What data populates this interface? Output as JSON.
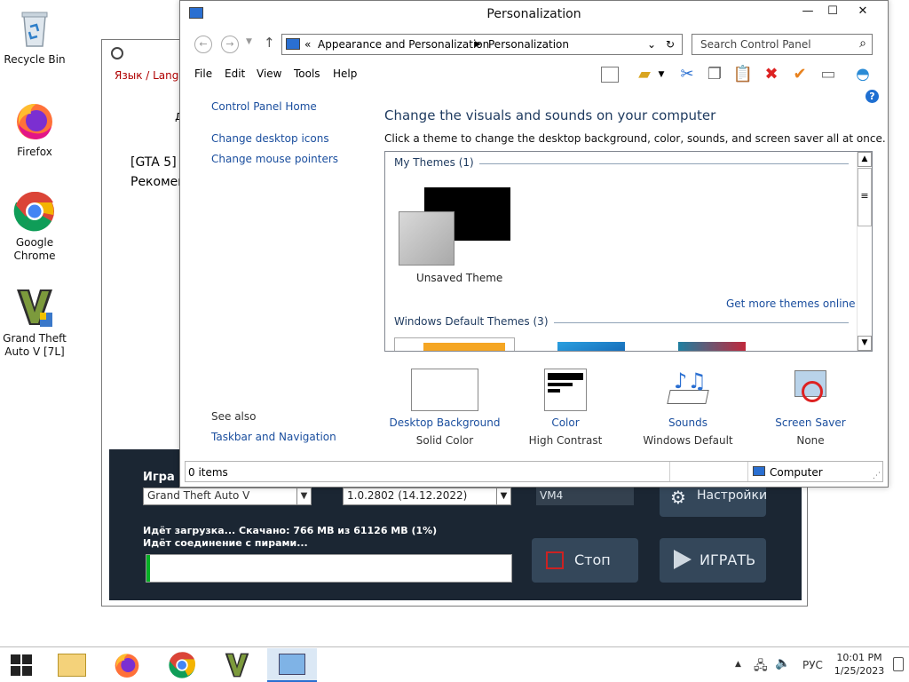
{
  "desktop": {
    "icons": [
      {
        "label": "Recycle Bin",
        "icon": "recycle-bin-icon"
      },
      {
        "label": "Firefox",
        "icon": "firefox-icon"
      },
      {
        "label": "Google Chrome",
        "icon": "chrome-icon"
      },
      {
        "label": "Grand Theft Auto V [7L]",
        "icon": "gta-v-icon"
      }
    ]
  },
  "launcher": {
    "lang_label": "Язык / Langu",
    "line1": "[GTA 5]",
    "line2": "Рекомен",
    "game_label": "Игра",
    "game_value": "Grand Theft Auto V",
    "version_value": "1.0.2802 (14.12.2022)",
    "vm_value": "VM4",
    "settings_label": "Настройки",
    "download_status": "Идёт загрузка... Скачано: 766 MB из 61126 MB (1%)",
    "peer_status": "Идёт соединение с пирами...",
    "progress": 0.01,
    "stop_label": "Стоп",
    "play_label": "ИГРАТЬ"
  },
  "window": {
    "title": "Personalization",
    "minimize": "—",
    "maximize": "☐",
    "close": "✕",
    "breadcrumb_prefix": "«",
    "breadcrumb": [
      "Appearance and Personalization",
      "Personalization"
    ],
    "search_placeholder": "Search Control Panel",
    "menu": [
      "File",
      "Edit",
      "View",
      "Tools",
      "Help"
    ],
    "sidebar": {
      "home": "Control Panel Home",
      "links": [
        "Change desktop icons",
        "Change mouse pointers"
      ],
      "see_also_label": "See also",
      "see_also_links": [
        "Taskbar and Navigation"
      ]
    },
    "main": {
      "heading": "Change the visuals and sounds on your computer",
      "subheading": "Click a theme to change the desktop background, color, sounds, and screen saver all at once.",
      "my_themes_header": "My Themes (1)",
      "unsaved_theme_label": "Unsaved Theme",
      "get_more_link": "Get more themes online",
      "default_themes_header": "Windows Default Themes (3)"
    },
    "bottom_items": [
      {
        "label": "Desktop Background",
        "sub": "Solid Color",
        "icon": "desktop-background-icon"
      },
      {
        "label": "Color",
        "sub": "High Contrast",
        "icon": "color-icon"
      },
      {
        "label": "Sounds",
        "sub": "Windows Default",
        "icon": "sounds-icon"
      },
      {
        "label": "Screen Saver",
        "sub": "None",
        "icon": "screen-saver-icon"
      }
    ],
    "status": {
      "items": "0 items",
      "location": "Computer"
    }
  },
  "taskbar": {
    "items": [
      "start-icon",
      "file-explorer-icon",
      "firefox-icon",
      "chrome-icon",
      "gta-v-icon",
      "control-panel-icon"
    ],
    "tray": {
      "lang": "РУС",
      "time": "10:01 PM",
      "date": "1/25/2023"
    }
  }
}
